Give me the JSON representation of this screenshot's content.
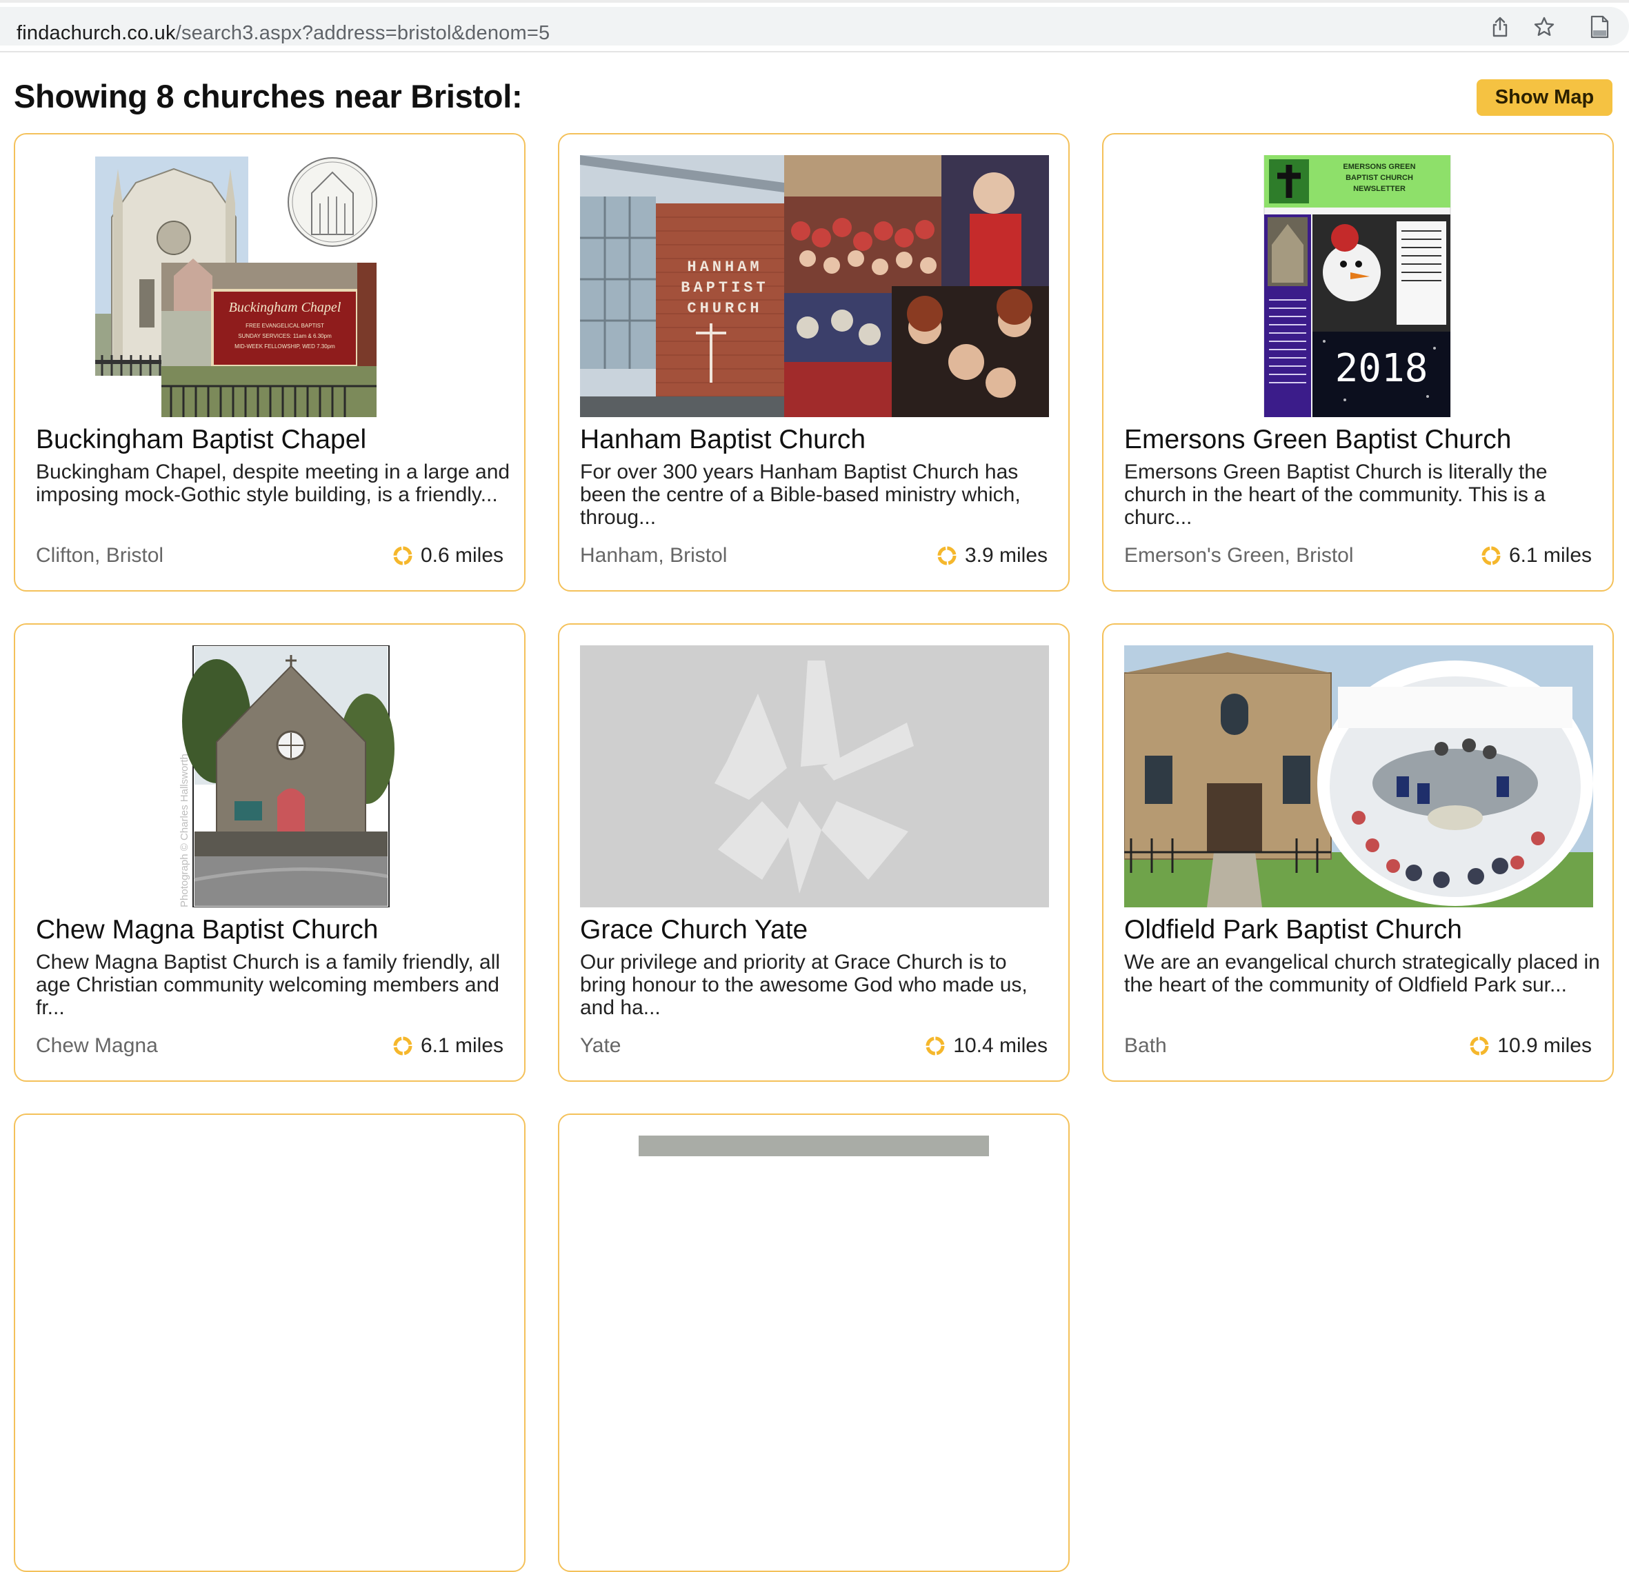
{
  "browser": {
    "url_host": "findachurch.co.uk",
    "url_path": "/search3.aspx?address=bristol&denom=5",
    "share_icon": "share-icon",
    "bookmark_icon": "star-icon",
    "extension_icon": "page-icon"
  },
  "page": {
    "heading": "Showing 8 churches near Bristol:",
    "show_map_label": "Show Map",
    "accent_color": "#f5c242",
    "card_border_color": "#f4c15a"
  },
  "cards": [
    {
      "title": "Buckingham Baptist Chapel",
      "description": "Buckingham Chapel, despite meeting in a large and imposing mock-Gothic style building, is a friendly...",
      "location": "Clifton, Bristol",
      "distance": "0.6 miles",
      "image": "chapel-photo-and-sign"
    },
    {
      "title": "Hanham Baptist Church",
      "description": "For over 300 years Hanham Baptist Church has been the centre of a Bible-based ministry which, throug...",
      "location": "Hanham, Bristol",
      "distance": "3.9 miles",
      "image": "church-building-collage",
      "sign_text": "HANHAM BAPTIST CHURCH"
    },
    {
      "title": "Emersons Green Baptist Church",
      "description": "Emersons Green Baptist Church is literally the church in the heart of the community. This is a churc...",
      "location": "Emerson's Green, Bristol",
      "distance": "6.1 miles",
      "image": "newsletter-cover",
      "newsletter_title": "EMERSONS GREEN BAPTIST CHURCH NEWSLETTER",
      "newsletter_year": "2018"
    },
    {
      "title": "Chew Magna Baptist Church",
      "description": "Chew Magna Baptist Church is a family friendly, all age Christian community welcoming members and fr...",
      "location": "Chew Magna",
      "distance": "6.1 miles",
      "image": "stone-chapel-photo",
      "photo_credit": "Photograph © Charles Hallsworth"
    },
    {
      "title": "Grace Church Yate",
      "description": "Our privilege and priority at Grace Church is to bring honour to the awesome God who made us, and ha...",
      "location": "Yate",
      "distance": "10.4 miles",
      "image": "placeholder-logo"
    },
    {
      "title": "Oldfield Park Baptist Church",
      "description": "We are an evangelical church strategically placed in the heart of the community of Oldfield Park sur...",
      "location": "Bath",
      "distance": "10.9 miles",
      "image": "church-facade-and-worship"
    }
  ]
}
